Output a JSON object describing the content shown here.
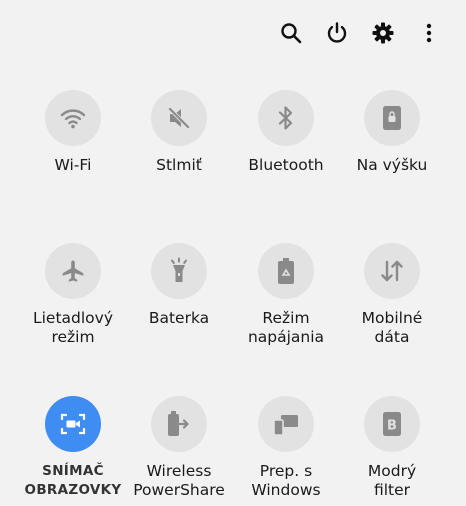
{
  "top_actions": [
    {
      "name": "search-icon"
    },
    {
      "name": "power-icon"
    },
    {
      "name": "gear-icon"
    },
    {
      "name": "more-vert-icon"
    }
  ],
  "tiles": [
    {
      "label": "Wi-Fi",
      "icon": "wifi-icon",
      "active": false
    },
    {
      "label": "Stlmiť",
      "icon": "mute-icon",
      "active": false
    },
    {
      "label": "Bluetooth",
      "icon": "bluetooth-icon",
      "active": false
    },
    {
      "label": "Na výšku",
      "icon": "portrait-lock-icon",
      "active": false
    },
    {
      "label": "Lietadlový\nrežim",
      "icon": "airplane-icon",
      "active": false
    },
    {
      "label": "Baterka",
      "icon": "flashlight-icon",
      "active": false
    },
    {
      "label": "Režim\nnapájania",
      "icon": "battery-recycle-icon",
      "active": false
    },
    {
      "label": "Mobilné\ndáta",
      "icon": "mobile-data-icon",
      "active": false
    },
    {
      "label": "SNÍMAČ\nOBRAZOVKY",
      "icon": "screen-recorder-icon",
      "active": true
    },
    {
      "label": "Wireless\nPowerShare",
      "icon": "wireless-powershare-icon",
      "active": false
    },
    {
      "label": "Prep. s\nWindows",
      "icon": "link-windows-icon",
      "active": false
    },
    {
      "label": "Modrý\nfilter",
      "icon": "blue-light-filter-icon",
      "active": false
    }
  ],
  "colors": {
    "accent": "#3f8cf2",
    "tile_bg": "#e2e2e2",
    "icon_gray": "#8a8a8a",
    "background": "#f2f2f2"
  }
}
